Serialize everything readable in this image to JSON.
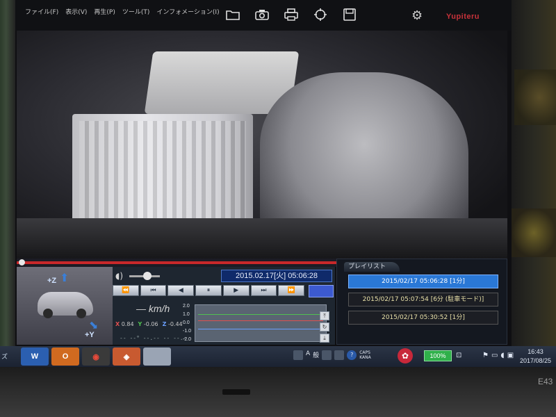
{
  "menubar": {
    "items": [
      "ファイル(F)",
      "表示(V)",
      "再生(P)",
      "ツール(T)",
      "インフォメーション(I)"
    ]
  },
  "toolbar": {
    "icons": [
      "open-folder-icon",
      "camera-icon",
      "print-icon",
      "zoom-icon",
      "save-icon"
    ]
  },
  "brand": {
    "logo_text": "Yupiteru"
  },
  "sensor": {
    "z_axis": "+Z",
    "y_axis": "+Y"
  },
  "player": {
    "datetime": "2015.02.17[火] 05:06:28",
    "progress": 0.015,
    "volume": 0.6,
    "speed_value": "—",
    "speed_unit": "km/h",
    "accel": {
      "x_label": "X",
      "x_value": "0.84",
      "y_label": "Y",
      "y_value": "-0.06",
      "z_label": "Z",
      "z_value": "-0.44"
    },
    "status_line": "-- --° --.-- -- --.-",
    "transport": [
      "⏪",
      "⏮",
      "◀",
      "⏸",
      "▶",
      "⏭",
      "⏩"
    ]
  },
  "graph": {
    "ticks": [
      "2.0",
      "1.0",
      "0.0",
      "-1.0",
      "-2.0"
    ],
    "side_buttons": [
      "⤒",
      "↻",
      "⤓"
    ]
  },
  "playlist": {
    "tab_label": "プレイリスト",
    "items": [
      "2015/02/17 05:06:28 [1分]",
      "2015/02/17 05:07:54 [6分 (駐車モード)]",
      "2015/02/17 05:30:52 [1分]"
    ],
    "selected_index": 0
  },
  "taskbar": {
    "apps": [
      "W",
      "O",
      "◉",
      "◈",
      ""
    ],
    "ime": [
      "A",
      "般"
    ],
    "caps": "CAPS",
    "kana": "KANA",
    "battery": "100%",
    "time": "16:43",
    "date": "2017/08/25"
  },
  "hardware": {
    "model": "E43"
  }
}
